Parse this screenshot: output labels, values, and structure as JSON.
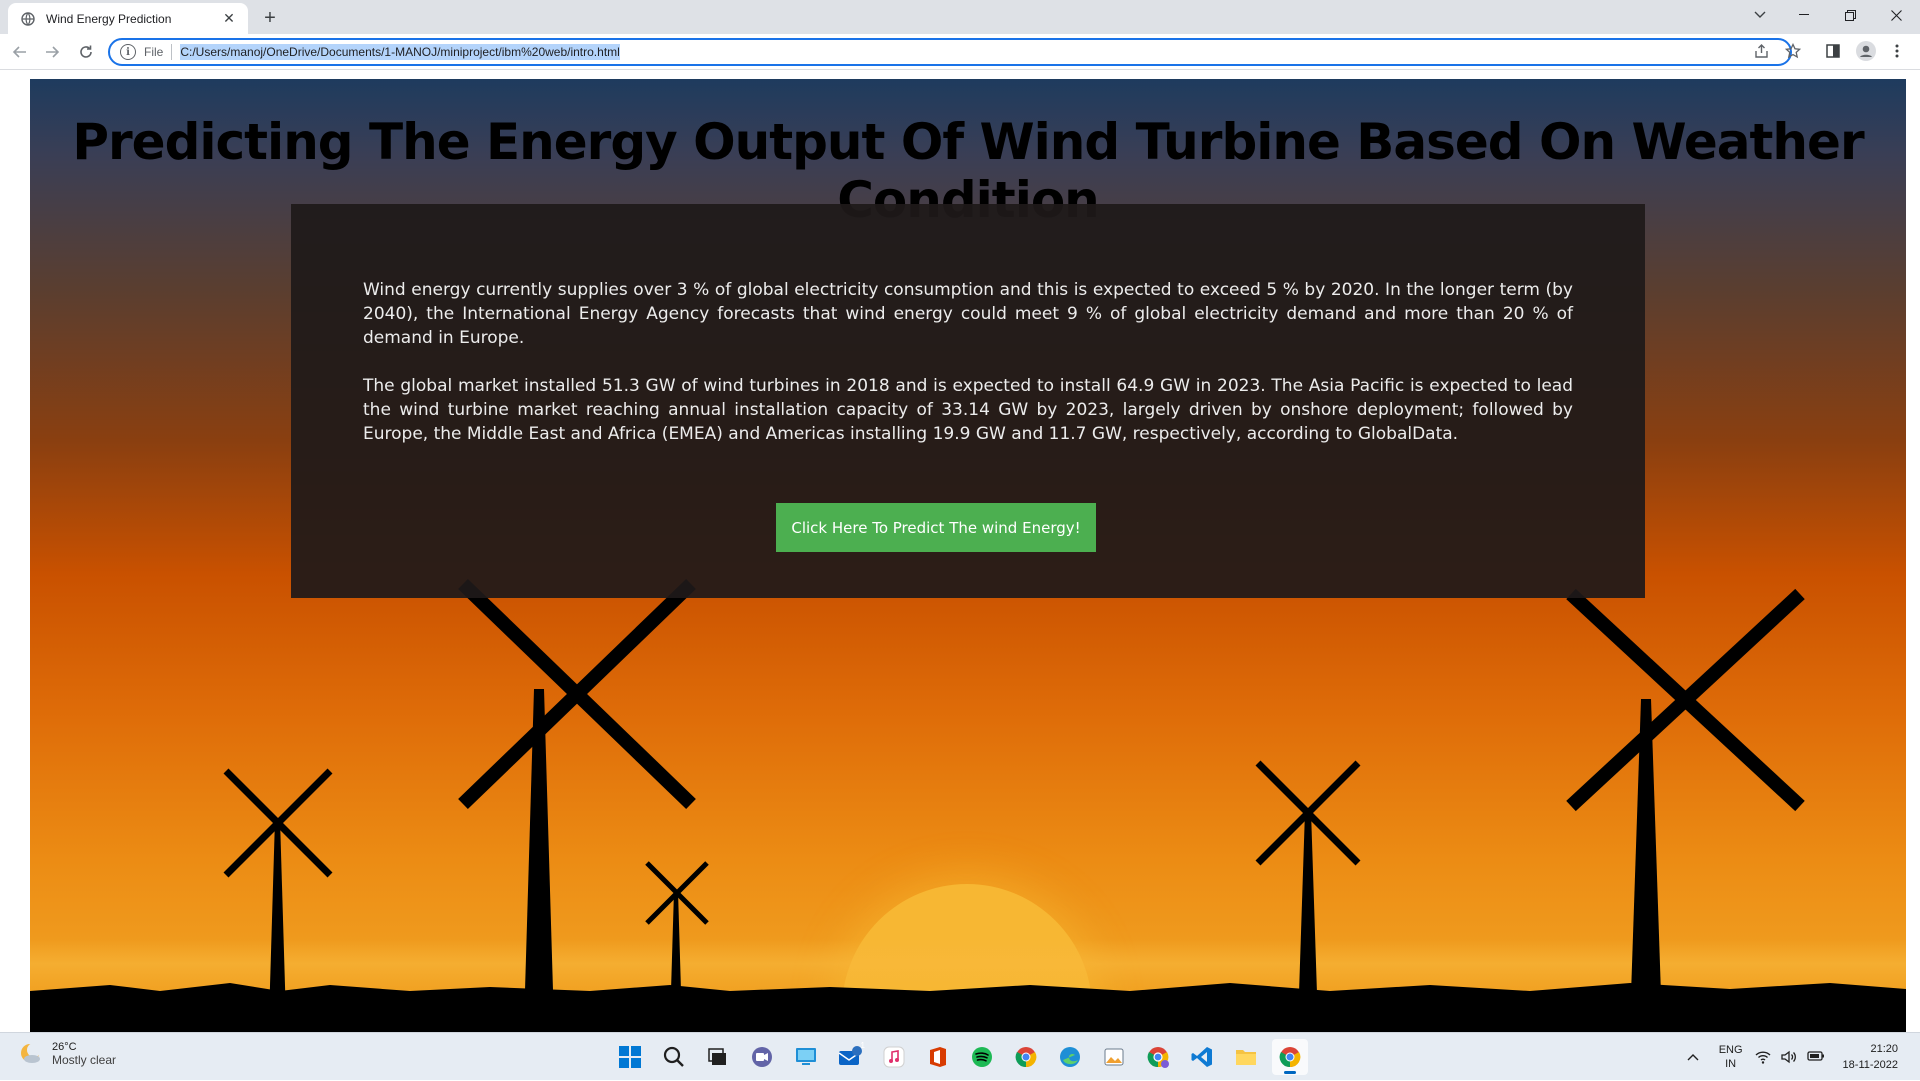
{
  "browser": {
    "tab_title": "Wind Energy Prediction",
    "url_scheme": "File",
    "url": "C:/Users/manoj/OneDrive/Documents/1-MANOJ/miniproject/ibm%20web/intro.html"
  },
  "page": {
    "title": "Predicting The Energy Output Of Wind Turbine Based On Weather Condition",
    "paragraph1": "Wind energy currently supplies over 3 % of global electricity consumption and this is expected to exceed 5 % by 2020. In the longer term (by 2040), the International Energy Agency forecasts that wind energy could meet 9 % of global electricity demand and more than 20 % of demand in Europe.",
    "paragraph2": "The global market installed 51.3 GW of wind turbines in 2018 and is expected to install 64.9 GW in 2023. The Asia Pacific is expected to lead the wind turbine market reaching annual installation capacity of 33.14 GW by 2023, largely driven by onshore deployment; followed by Europe, the Middle East and Africa (EMEA) and Americas installing 19.9 GW and 11.7 GW, respectively, according to GlobalData.",
    "predict_button": "Click Here To Predict The wind Energy!"
  },
  "taskbar": {
    "weather_temp": "26°C",
    "weather_desc": "Mostly clear",
    "mail_badge": "1",
    "lang_line1": "ENG",
    "lang_line2": "IN",
    "time": "21:20",
    "date": "18-11-2022"
  },
  "colors": {
    "button": "#4caf50",
    "url_highlight": "#b4d4fb",
    "omnibox_focus": "#1a73e8"
  }
}
